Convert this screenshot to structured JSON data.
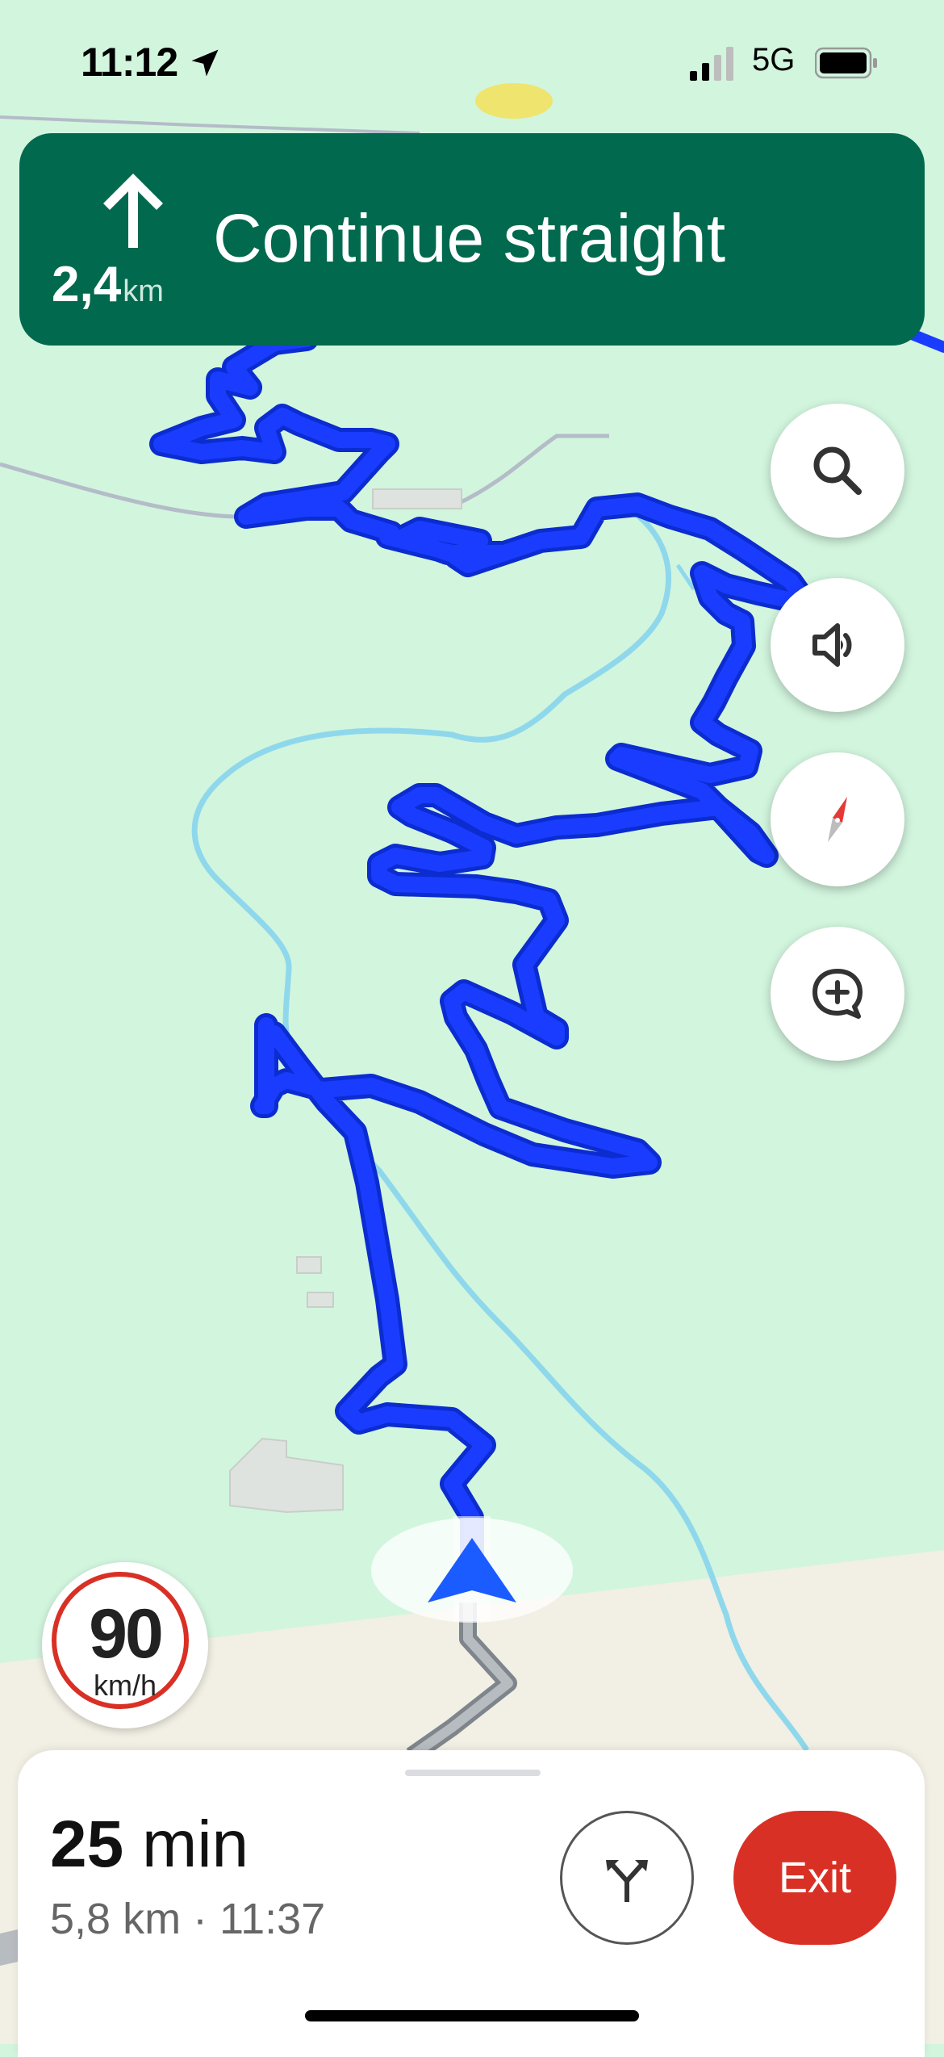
{
  "status_bar": {
    "time": "11:12",
    "network": "5G",
    "icons": [
      "location-arrow-icon",
      "signal-bars-icon",
      "battery-icon"
    ]
  },
  "banner": {
    "maneuver_icon": "arrow-up-icon",
    "distance_value": "2,4",
    "distance_unit": "km",
    "instruction": "Continue straight",
    "background": "#01694d"
  },
  "map_controls": [
    {
      "name": "search",
      "icon": "search-icon"
    },
    {
      "name": "sound",
      "icon": "speaker-icon"
    },
    {
      "name": "compass",
      "icon": "compass-icon"
    },
    {
      "name": "report",
      "icon": "add-report-icon"
    }
  ],
  "speed_limit": {
    "value": "90",
    "unit": "km/h"
  },
  "trip": {
    "duration_value": "25",
    "duration_unit": "min",
    "summary": "5,8 km · 11:37",
    "alternate_routes_icon": "alternate-routes-icon",
    "exit_label": "Exit",
    "exit_color": "#d93025"
  },
  "map_colors": {
    "terrain": "#d2f5de",
    "valley": "#f2efe4",
    "route": "#1a3cff",
    "water": "#8fd8ec",
    "road": "#9ba2a8"
  }
}
